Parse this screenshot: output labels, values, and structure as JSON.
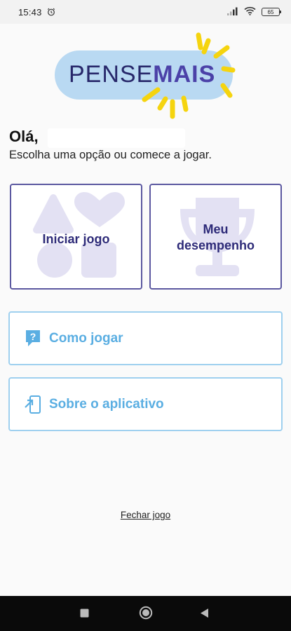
{
  "status_bar": {
    "time": "15:43",
    "battery": "65",
    "icons": [
      "alarm-icon",
      "signal-icon",
      "wifi-icon",
      "battery-icon"
    ]
  },
  "logo": {
    "word1": "PENSE",
    "word2": "MAIS"
  },
  "greeting": {
    "hello": "Olá,",
    "subtitle": "Escolha uma opção ou comece a jogar."
  },
  "cards": {
    "start_label": "Iniciar jogo",
    "performance_label_line1": "Meu",
    "performance_label_line2": "desempenho"
  },
  "buttons": {
    "how_to_play": "Como jogar",
    "about_app": "Sobre o aplicativo"
  },
  "footer": {
    "close_game": "Fechar jogo"
  },
  "colors": {
    "accent_dark": "#2d2a78",
    "accent_light": "#5aaee2",
    "logo_pill": "#b9d9f2",
    "ray_yellow": "#f5d40f",
    "shape_fill": "#e3e1f3"
  }
}
